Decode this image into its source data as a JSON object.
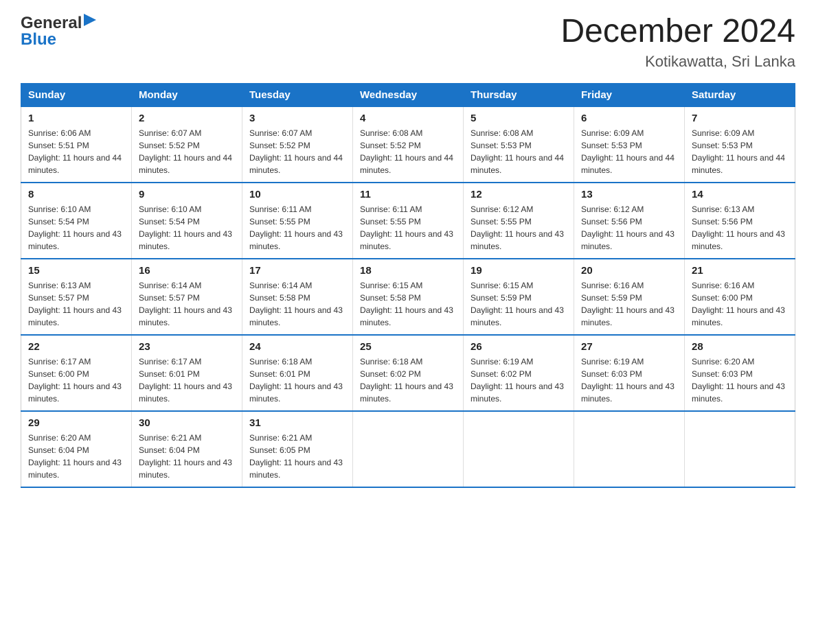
{
  "header": {
    "logo_general": "General",
    "logo_blue": "Blue",
    "month_title": "December 2024",
    "location": "Kotikawatta, Sri Lanka"
  },
  "days_of_week": [
    "Sunday",
    "Monday",
    "Tuesday",
    "Wednesday",
    "Thursday",
    "Friday",
    "Saturday"
  ],
  "weeks": [
    [
      {
        "day": "1",
        "sunrise": "6:06 AM",
        "sunset": "5:51 PM",
        "daylight": "11 hours and 44 minutes."
      },
      {
        "day": "2",
        "sunrise": "6:07 AM",
        "sunset": "5:52 PM",
        "daylight": "11 hours and 44 minutes."
      },
      {
        "day": "3",
        "sunrise": "6:07 AM",
        "sunset": "5:52 PM",
        "daylight": "11 hours and 44 minutes."
      },
      {
        "day": "4",
        "sunrise": "6:08 AM",
        "sunset": "5:52 PM",
        "daylight": "11 hours and 44 minutes."
      },
      {
        "day": "5",
        "sunrise": "6:08 AM",
        "sunset": "5:53 PM",
        "daylight": "11 hours and 44 minutes."
      },
      {
        "day": "6",
        "sunrise": "6:09 AM",
        "sunset": "5:53 PM",
        "daylight": "11 hours and 44 minutes."
      },
      {
        "day": "7",
        "sunrise": "6:09 AM",
        "sunset": "5:53 PM",
        "daylight": "11 hours and 44 minutes."
      }
    ],
    [
      {
        "day": "8",
        "sunrise": "6:10 AM",
        "sunset": "5:54 PM",
        "daylight": "11 hours and 43 minutes."
      },
      {
        "day": "9",
        "sunrise": "6:10 AM",
        "sunset": "5:54 PM",
        "daylight": "11 hours and 43 minutes."
      },
      {
        "day": "10",
        "sunrise": "6:11 AM",
        "sunset": "5:55 PM",
        "daylight": "11 hours and 43 minutes."
      },
      {
        "day": "11",
        "sunrise": "6:11 AM",
        "sunset": "5:55 PM",
        "daylight": "11 hours and 43 minutes."
      },
      {
        "day": "12",
        "sunrise": "6:12 AM",
        "sunset": "5:55 PM",
        "daylight": "11 hours and 43 minutes."
      },
      {
        "day": "13",
        "sunrise": "6:12 AM",
        "sunset": "5:56 PM",
        "daylight": "11 hours and 43 minutes."
      },
      {
        "day": "14",
        "sunrise": "6:13 AM",
        "sunset": "5:56 PM",
        "daylight": "11 hours and 43 minutes."
      }
    ],
    [
      {
        "day": "15",
        "sunrise": "6:13 AM",
        "sunset": "5:57 PM",
        "daylight": "11 hours and 43 minutes."
      },
      {
        "day": "16",
        "sunrise": "6:14 AM",
        "sunset": "5:57 PM",
        "daylight": "11 hours and 43 minutes."
      },
      {
        "day": "17",
        "sunrise": "6:14 AM",
        "sunset": "5:58 PM",
        "daylight": "11 hours and 43 minutes."
      },
      {
        "day": "18",
        "sunrise": "6:15 AM",
        "sunset": "5:58 PM",
        "daylight": "11 hours and 43 minutes."
      },
      {
        "day": "19",
        "sunrise": "6:15 AM",
        "sunset": "5:59 PM",
        "daylight": "11 hours and 43 minutes."
      },
      {
        "day": "20",
        "sunrise": "6:16 AM",
        "sunset": "5:59 PM",
        "daylight": "11 hours and 43 minutes."
      },
      {
        "day": "21",
        "sunrise": "6:16 AM",
        "sunset": "6:00 PM",
        "daylight": "11 hours and 43 minutes."
      }
    ],
    [
      {
        "day": "22",
        "sunrise": "6:17 AM",
        "sunset": "6:00 PM",
        "daylight": "11 hours and 43 minutes."
      },
      {
        "day": "23",
        "sunrise": "6:17 AM",
        "sunset": "6:01 PM",
        "daylight": "11 hours and 43 minutes."
      },
      {
        "day": "24",
        "sunrise": "6:18 AM",
        "sunset": "6:01 PM",
        "daylight": "11 hours and 43 minutes."
      },
      {
        "day": "25",
        "sunrise": "6:18 AM",
        "sunset": "6:02 PM",
        "daylight": "11 hours and 43 minutes."
      },
      {
        "day": "26",
        "sunrise": "6:19 AM",
        "sunset": "6:02 PM",
        "daylight": "11 hours and 43 minutes."
      },
      {
        "day": "27",
        "sunrise": "6:19 AM",
        "sunset": "6:03 PM",
        "daylight": "11 hours and 43 minutes."
      },
      {
        "day": "28",
        "sunrise": "6:20 AM",
        "sunset": "6:03 PM",
        "daylight": "11 hours and 43 minutes."
      }
    ],
    [
      {
        "day": "29",
        "sunrise": "6:20 AM",
        "sunset": "6:04 PM",
        "daylight": "11 hours and 43 minutes."
      },
      {
        "day": "30",
        "sunrise": "6:21 AM",
        "sunset": "6:04 PM",
        "daylight": "11 hours and 43 minutes."
      },
      {
        "day": "31",
        "sunrise": "6:21 AM",
        "sunset": "6:05 PM",
        "daylight": "11 hours and 43 minutes."
      },
      null,
      null,
      null,
      null
    ]
  ],
  "labels": {
    "sunrise_prefix": "Sunrise: ",
    "sunset_prefix": "Sunset: ",
    "daylight_prefix": "Daylight: "
  }
}
